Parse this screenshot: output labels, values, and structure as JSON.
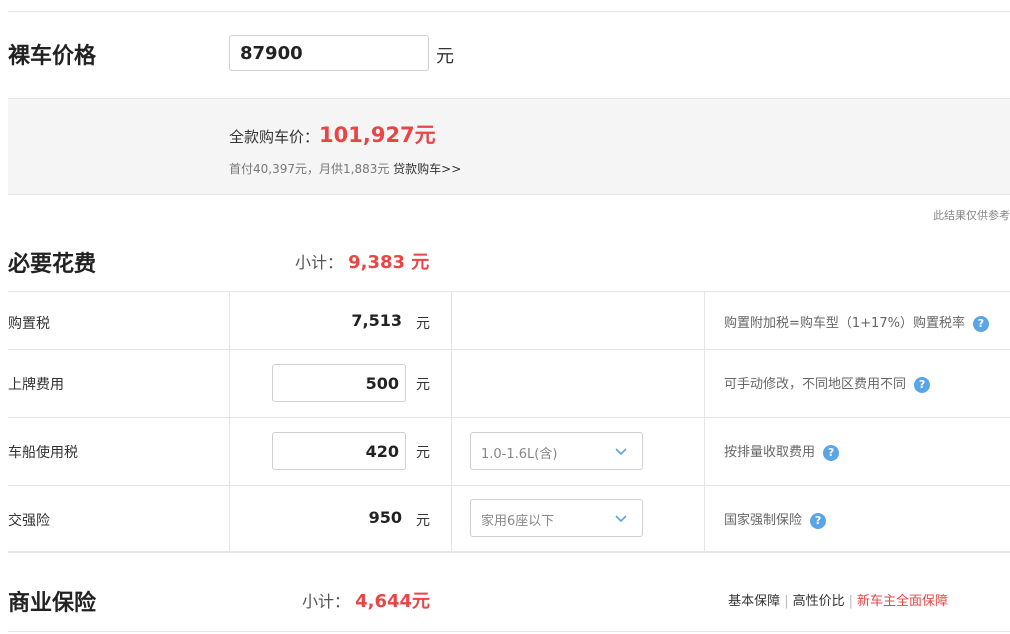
{
  "bare_price": {
    "label": "裸车价格",
    "value": "87900",
    "unit": "元"
  },
  "summary": {
    "total_label": "全款购车价：",
    "total_value": "101,927元",
    "down_payment_text": "首付40,397元，月供1,883元",
    "loan_link": "贷款购车>>"
  },
  "disclaimer": "此结果仅供参考",
  "required": {
    "title": "必要花费",
    "subtotal_label": "小计：",
    "subtotal_value": "9,383 元",
    "rows": [
      {
        "label": "购置税",
        "amount": "7,513",
        "unit": "元",
        "desc": "购置附加税=购车型（1+17%）购置税率",
        "help": "?"
      },
      {
        "label": "上牌费用",
        "amount": "500",
        "unit": "元",
        "desc": "可手动修改，不同地区费用不同",
        "help": "?"
      },
      {
        "label": "车船使用税",
        "amount": "420",
        "unit": "元",
        "select": "1.0-1.6L(含)",
        "desc": "按排量收取费用",
        "help": "?"
      },
      {
        "label": "交强险",
        "amount": "950",
        "unit": "元",
        "select": "家用6座以下",
        "desc": "国家强制保险",
        "help": "?"
      }
    ]
  },
  "commercial": {
    "title": "商业保险",
    "subtotal_label": "小计：",
    "subtotal_value": "4,644元",
    "options": [
      "基本保障",
      "高性价比",
      "新车主全面保障"
    ]
  },
  "colors": {
    "accent_red": "#e84545",
    "help_blue": "#5aa5e6",
    "border": "#e5e5e5"
  }
}
